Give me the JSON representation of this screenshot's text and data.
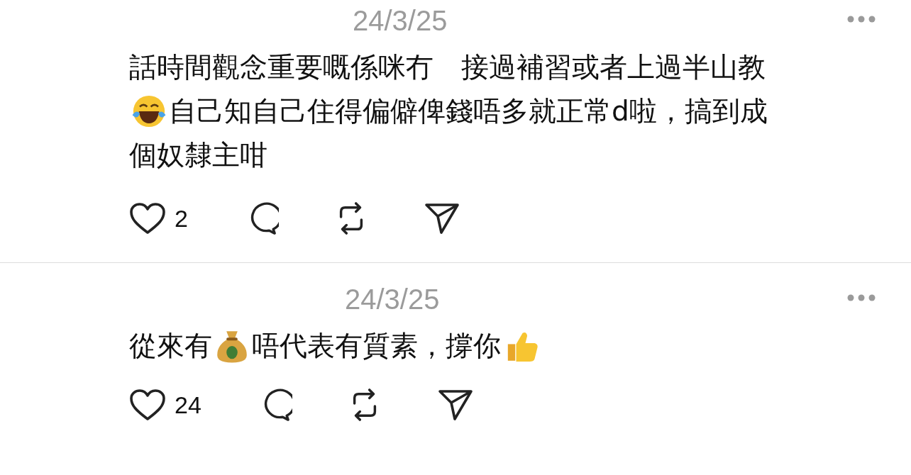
{
  "posts": [
    {
      "date": "24/3/25",
      "body": [
        [
          {
            "kind": "text",
            "text": "話時間觀念重要嘅係咪冇　接過補習或者上過半山教"
          }
        ],
        [
          {
            "kind": "laugh"
          },
          {
            "kind": "text",
            "text": "自己知自己住得偏僻俾錢唔多就正常d啦，搞到成"
          }
        ],
        [
          {
            "kind": "text",
            "text": "個奴隸主咁"
          }
        ]
      ],
      "likes": "2"
    },
    {
      "date": "24/3/25",
      "body": [
        [
          {
            "kind": "text",
            "text": "從來有"
          },
          {
            "kind": "money"
          },
          {
            "kind": "text",
            "text": "唔代表有質素，撐你"
          },
          {
            "kind": "thumbs"
          }
        ]
      ],
      "likes": "24"
    }
  ]
}
